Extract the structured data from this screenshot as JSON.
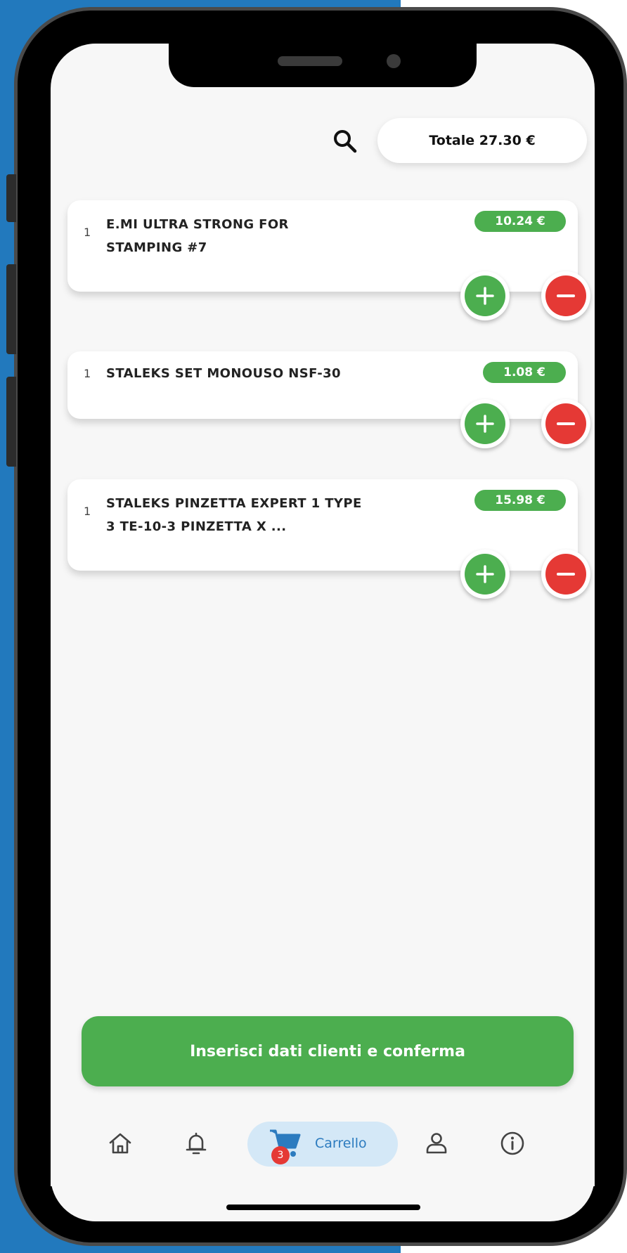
{
  "header": {
    "total_label": "Totale 27.30 €"
  },
  "cart_items": [
    {
      "qty": "1",
      "title_line1": "E.MI ULTRA STRONG FOR",
      "title_line2": "STAMPING #7",
      "price": "10.24 €"
    },
    {
      "qty": "1",
      "title_line1": "STALEKS SET MONOUSO NSF-30",
      "title_line2": "",
      "price": "1.08 €"
    },
    {
      "qty": "1",
      "title_line1": "STALEKS PINZETTA EXPERT 1 TYPE",
      "title_line2": "3 TE-10-3 PINZETTA X ...",
      "price": "15.98 €"
    }
  ],
  "confirm_button": {
    "label": "Inserisci dati clienti e conferma"
  },
  "bottom_nav": {
    "items": [
      "home-icon",
      "bell-icon",
      "cart-icon",
      "user-icon",
      "info-icon"
    ],
    "cart_label": "Carrello",
    "cart_badge": "3",
    "active": "cart"
  },
  "colors": {
    "green": "#4cae4f",
    "red": "#e53935",
    "accent_blue": "#2c7bbf",
    "background_blue": "#2279bd"
  }
}
